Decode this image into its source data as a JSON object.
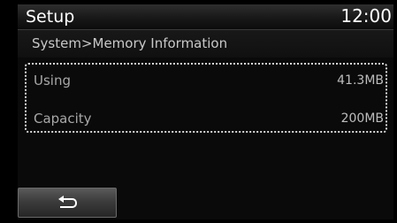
{
  "header": {
    "title": "Setup",
    "clock": "12:00"
  },
  "breadcrumb": {
    "text": "System>Memory Information"
  },
  "memory_info": {
    "rows": [
      {
        "label": "Using",
        "value": "41.3MB"
      },
      {
        "label": "Capacity",
        "value": "200MB"
      }
    ]
  },
  "footer": {
    "back_button_icon": "return-arrow-icon"
  },
  "colors": {
    "background": "#000000",
    "header_text": "#ffffff",
    "label_text": "#a8a8a8",
    "selection_border": "#d8d8d8"
  }
}
